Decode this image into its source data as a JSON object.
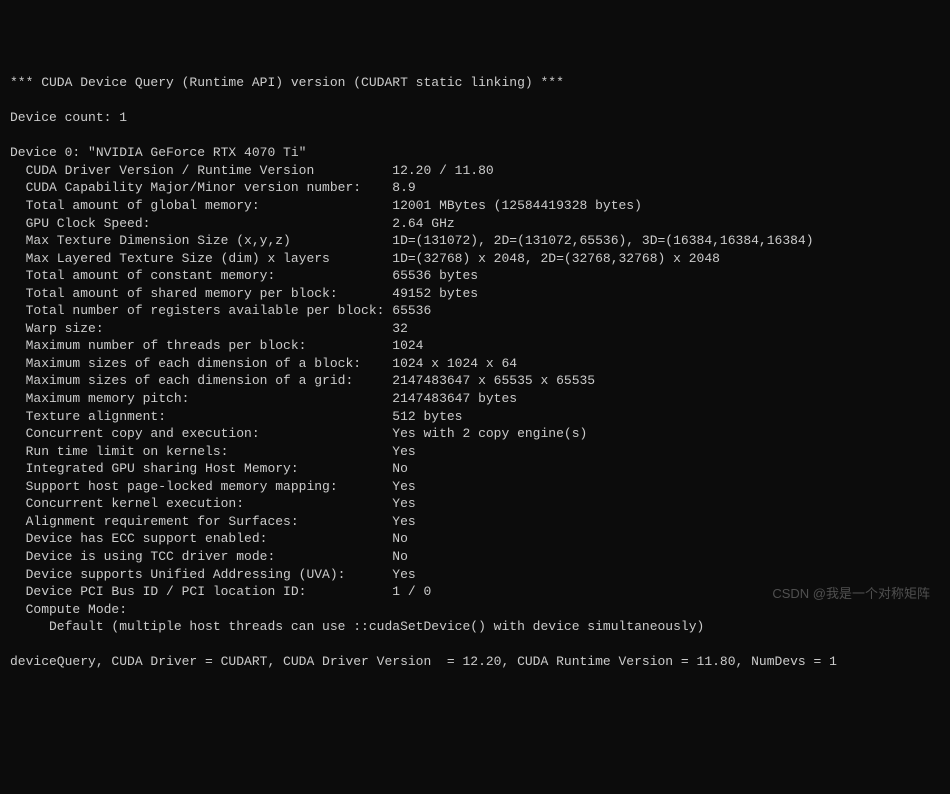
{
  "header": "*** CUDA Device Query (Runtime API) version (CUDART static linking) ***",
  "blank1": "",
  "device_count": "Device count: 1",
  "blank2": "",
  "device_header": "Device 0: \"NVIDIA GeForce RTX 4070 Ti\"",
  "props": [
    "  CUDA Driver Version / Runtime Version          12.20 / 11.80",
    "  CUDA Capability Major/Minor version number:    8.9",
    "  Total amount of global memory:                 12001 MBytes (12584419328 bytes)",
    "  GPU Clock Speed:                               2.64 GHz",
    "  Max Texture Dimension Size (x,y,z)             1D=(131072), 2D=(131072,65536), 3D=(16384,16384,16384)",
    "  Max Layered Texture Size (dim) x layers        1D=(32768) x 2048, 2D=(32768,32768) x 2048",
    "  Total amount of constant memory:               65536 bytes",
    "  Total amount of shared memory per block:       49152 bytes",
    "  Total number of registers available per block: 65536",
    "  Warp size:                                     32",
    "  Maximum number of threads per block:           1024",
    "  Maximum sizes of each dimension of a block:    1024 x 1024 x 64",
    "  Maximum sizes of each dimension of a grid:     2147483647 x 65535 x 65535",
    "  Maximum memory pitch:                          2147483647 bytes",
    "  Texture alignment:                             512 bytes",
    "  Concurrent copy and execution:                 Yes with 2 copy engine(s)",
    "  Run time limit on kernels:                     Yes",
    "  Integrated GPU sharing Host Memory:            No",
    "  Support host page-locked memory mapping:       Yes",
    "  Concurrent kernel execution:                   Yes",
    "  Alignment requirement for Surfaces:            Yes",
    "  Device has ECC support enabled:                No",
    "  Device is using TCC driver mode:               No",
    "  Device supports Unified Addressing (UVA):      Yes",
    "  Device PCI Bus ID / PCI location ID:           1 / 0",
    "  Compute Mode:",
    "     Default (multiple host threads can use ::cudaSetDevice() with device simultaneously)"
  ],
  "blank3": "",
  "footer": "deviceQuery, CUDA Driver = CUDART, CUDA Driver Version  = 12.20, CUDA Runtime Version = 11.80, NumDevs = 1",
  "watermark": "CSDN @我是一个对称矩阵"
}
